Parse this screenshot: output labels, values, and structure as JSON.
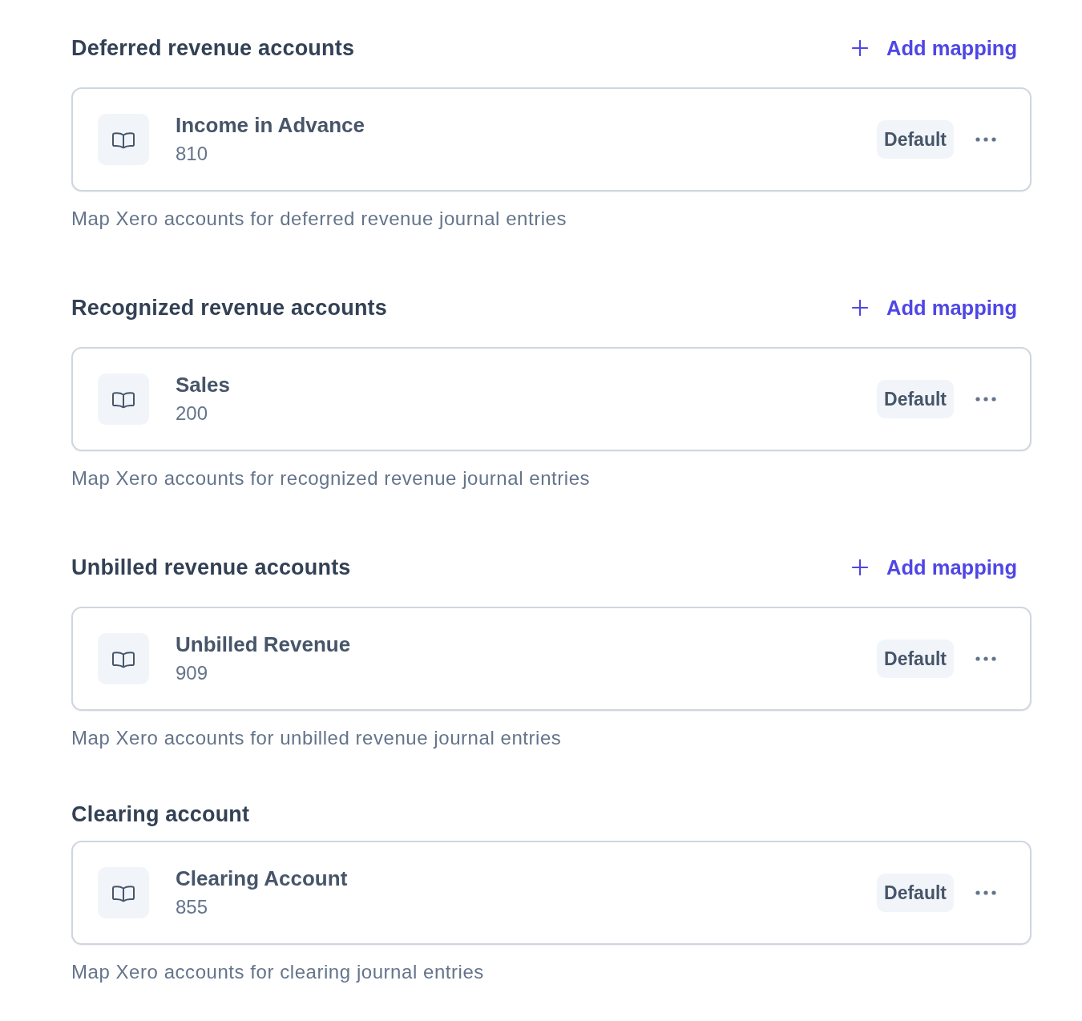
{
  "sections": [
    {
      "title": "Deferred revenue accounts",
      "add_button": "Add mapping",
      "accounts": [
        {
          "name": "Income in Advance",
          "code": "810",
          "badge": "Default"
        }
      ],
      "description": "Map Xero accounts for deferred revenue journal entries"
    },
    {
      "title": "Recognized revenue accounts",
      "add_button": "Add mapping",
      "accounts": [
        {
          "name": "Sales",
          "code": "200",
          "badge": "Default"
        }
      ],
      "description": "Map Xero accounts for recognized revenue journal entries"
    },
    {
      "title": "Unbilled revenue accounts",
      "add_button": "Add mapping",
      "accounts": [
        {
          "name": "Unbilled Revenue",
          "code": "909",
          "badge": "Default"
        }
      ],
      "description": "Map Xero accounts for unbilled revenue journal entries"
    },
    {
      "title": "Clearing account",
      "accounts": [
        {
          "name": "Clearing Account",
          "code": "855",
          "badge": "Default"
        }
      ],
      "description": "Map Xero accounts for clearing journal entries"
    }
  ]
}
